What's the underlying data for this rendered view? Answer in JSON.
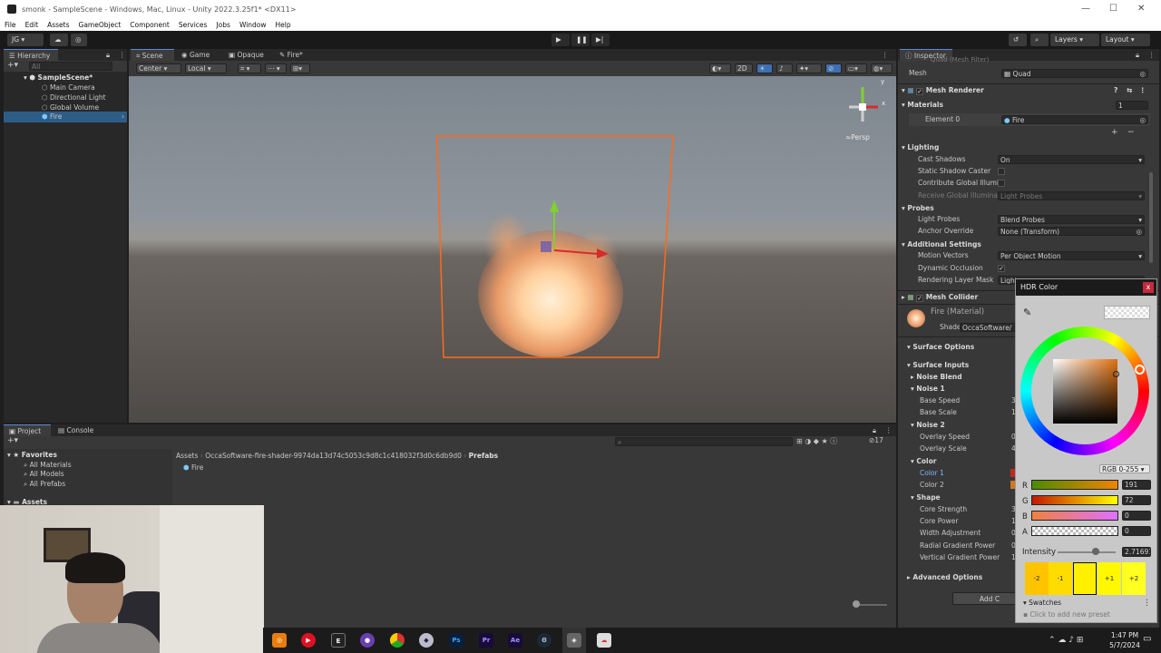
{
  "window": {
    "title": "smonk - SampleScene - Windows, Mac, Linux - Unity 2022.3.25f1* <DX11>",
    "min": "—",
    "max": "☐",
    "close": "✕"
  },
  "menu": [
    "File",
    "Edit",
    "Assets",
    "GameObject",
    "Component",
    "Services",
    "Jobs",
    "Window",
    "Help"
  ],
  "toolbar": {
    "account": "JG",
    "layers": "Layers",
    "layout": "Layout"
  },
  "hierarchy": {
    "title": "Hierarchy",
    "search_placeholder": "All",
    "scene": "SampleScene*",
    "items": [
      "Main Camera",
      "Directional Light",
      "Global Volume",
      "Fire"
    ]
  },
  "scene_tabs": [
    "Scene",
    "Game",
    "Opaque",
    "Fire*"
  ],
  "scene_toolbar": {
    "pivot": "Center",
    "space": "Local",
    "mode2d": "2D"
  },
  "gizmo": {
    "persp": "Persp",
    "x": "x",
    "y": "y"
  },
  "project": {
    "tabs": [
      "Project",
      "Console"
    ],
    "favorites": "Favorites",
    "fav_items": [
      "All Materials",
      "All Models",
      "All Prefabs"
    ],
    "assets": "Assets",
    "breadcrumb": [
      "Assets",
      "OccaSoftware-fire-shader-9974da13d74c5053c9d8c1c418032f3d0c6db9d0",
      "Prefabs"
    ],
    "file": "Fire",
    "count": "17"
  },
  "inspector": {
    "title": "Inspector",
    "mesh_filter": "Quad (Mesh Filter)",
    "mesh_label": "Mesh",
    "mesh_value": "Quad",
    "mesh_renderer": "Mesh Renderer",
    "materials": "Materials",
    "materials_count": "1",
    "element0": "Element 0",
    "element0_value": "Fire",
    "lighting": "Lighting",
    "cast_shadows": "Cast Shadows",
    "cast_shadows_value": "On",
    "static_shadow": "Static Shadow Caster",
    "contribute_gi": "Contribute Global Illumi",
    "receive_gi": "Receive Global Illumina",
    "receive_gi_value": "Light Probes",
    "probes": "Probes",
    "light_probes": "Light Probes",
    "light_probes_value": "Blend Probes",
    "anchor_override": "Anchor Override",
    "anchor_override_value": "None (Transform)",
    "additional": "Additional Settings",
    "motion_vectors": "Motion Vectors",
    "motion_vectors_value": "Per Object Motion",
    "dynamic_occlusion": "Dynamic Occlusion",
    "rendering_layer": "Rendering Layer Mask",
    "rendering_layer_value": "Light",
    "mesh_collider": "Mesh Collider",
    "material_name": "Fire (Material)",
    "shader_label": "Shader",
    "shader_value": "OccaSoftware/",
    "surface_options": "Surface Options",
    "surface_inputs": "Surface Inputs",
    "noise_blend": "Noise Blend",
    "noise1": "Noise 1",
    "base_speed": "Base Speed",
    "base_speed_v": "3",
    "base_scale": "Base Scale",
    "base_scale_v": "1",
    "noise2": "Noise 2",
    "overlay_speed": "Overlay Speed",
    "overlay_speed_v": "0",
    "overlay_scale": "Overlay Scale",
    "overlay_scale_v": "4",
    "color": "Color",
    "color1": "Color 1",
    "color2": "Color 2",
    "shape": "Shape",
    "core_strength": "Core Strength",
    "core_strength_v": "3",
    "core_power": "Core Power",
    "core_power_v": "1",
    "width_adj": "Width Adjustment",
    "width_adj_v": "0",
    "radial": "Radial Gradient Power",
    "radial_v": "0",
    "vertical": "Vertical Gradient Power",
    "vertical_v": "1",
    "advanced": "Advanced Options",
    "add_component": "Add C"
  },
  "hdr": {
    "title": "HDR Color",
    "close": "x",
    "mode": "RGB 0-255",
    "r_label": "R",
    "r": "191",
    "g_label": "G",
    "g": "72",
    "b_label": "B",
    "b": "0",
    "a_label": "A",
    "a": "0",
    "intensity_label": "Intensity",
    "intensity": "2.71691",
    "steps": [
      "-2",
      "-1",
      "",
      "+1",
      "+2"
    ],
    "swatches": "Swatches",
    "add_preset": "Click to add new preset",
    "accent": "#BF4800"
  },
  "clock": {
    "time": "1:47 PM",
    "date": "5/7/2024"
  },
  "taskbar_icons": [
    "blender-icon",
    "youtube-icon",
    "epic-icon",
    "obs-icon",
    "chrome-icon",
    "app-icon",
    "ps-icon",
    "pr-icon",
    "ae-icon",
    "steam-icon",
    "unity-icon",
    "discord-icon"
  ]
}
